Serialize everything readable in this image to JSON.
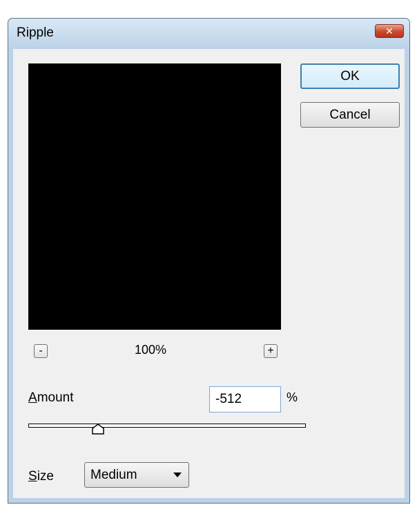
{
  "window": {
    "title": "Ripple",
    "close_glyph": "✕"
  },
  "buttons": {
    "ok_label": "OK",
    "cancel_label": "Cancel"
  },
  "zoom": {
    "minus_glyph": "-",
    "plus_glyph": "+",
    "level": "100%"
  },
  "amount": {
    "label_underlined": "A",
    "label_rest": "mount",
    "value": "-512",
    "unit": "%",
    "slider_fraction": 0.25
  },
  "size": {
    "label_underlined": "S",
    "label_rest": "ize",
    "selected": "Medium"
  },
  "icons": {
    "close": "close-icon",
    "minus": "minus-icon",
    "plus": "plus-icon",
    "slider_thumb": "slider-thumb-icon",
    "dropdown": "chevron-down-icon"
  },
  "colors": {
    "preview_background": "#000000",
    "dialog_background": "#f0f0f0",
    "close_button": "#c9492c",
    "default_button_border": "#3c7fb1"
  }
}
